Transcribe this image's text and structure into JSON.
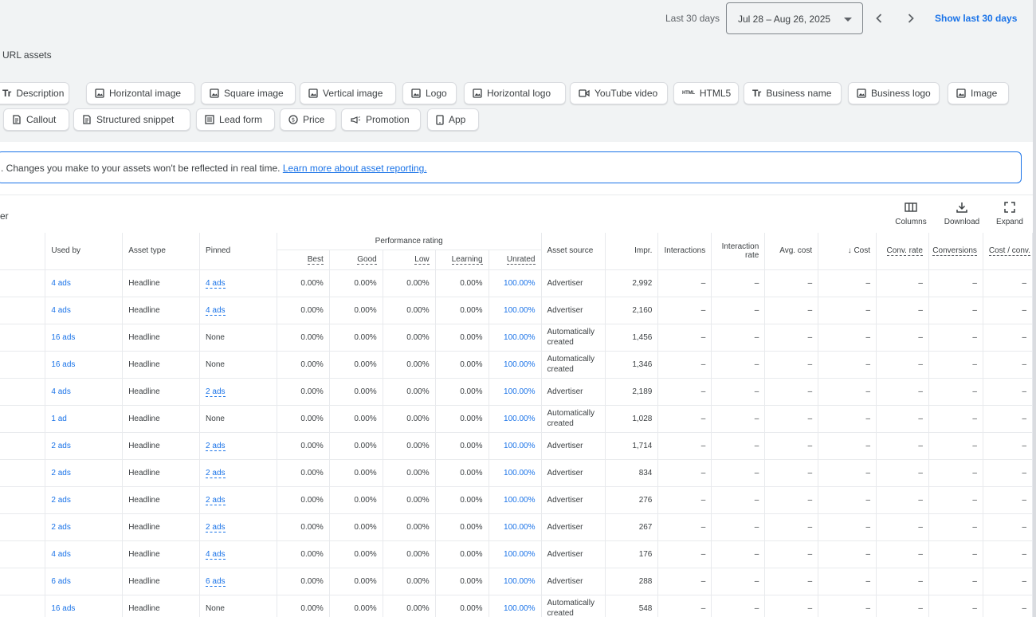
{
  "header": {
    "range_label": "Last 30 days",
    "date_range": "Jul 28 – Aug 26, 2025",
    "show_last": "Show last 30 days"
  },
  "section_title": "URL assets",
  "chips_row1": [
    {
      "label": "Description",
      "icon": "text-icon"
    },
    {
      "label": "Horizontal image",
      "icon": "image-icon"
    },
    {
      "label": "Square image",
      "icon": "image-icon"
    },
    {
      "label": "Vertical image",
      "icon": "image-icon"
    },
    {
      "label": "Logo",
      "icon": "image-icon"
    },
    {
      "label": "Horizontal logo",
      "icon": "image-icon"
    },
    {
      "label": "YouTube video",
      "icon": "video-icon"
    },
    {
      "label": "HTML5",
      "icon": "html5-icon"
    },
    {
      "label": "Business name",
      "icon": "text-icon"
    },
    {
      "label": "Business logo",
      "icon": "image-icon"
    },
    {
      "label": "Image",
      "icon": "image-icon"
    }
  ],
  "chips_row2": [
    {
      "label": "Callout",
      "icon": "callout-icon"
    },
    {
      "label": "Structured snippet",
      "icon": "callout-icon"
    },
    {
      "label": "Lead form",
      "icon": "form-icon"
    },
    {
      "label": "Price",
      "icon": "price-icon"
    },
    {
      "label": "Promotion",
      "icon": "promotion-icon"
    },
    {
      "label": "App",
      "icon": "phone-icon"
    }
  ],
  "banner": {
    "text": ". Changes you make to your assets won't be reflected in real time. ",
    "link": "Learn more about asset reporting."
  },
  "filter_fragment": "er",
  "toolbar": {
    "columns": "Columns",
    "download": "Download",
    "expand": "Expand"
  },
  "table": {
    "headers": {
      "used_by": "Used by",
      "asset_type": "Asset type",
      "pinned": "Pinned",
      "performance": "Performance rating",
      "best": "Best",
      "good": "Good",
      "low": "Low",
      "learning": "Learning",
      "unrated": "Unrated",
      "asset_source": "Asset source",
      "impr": "Impr.",
      "interactions": "Interactions",
      "interaction_rate": "Interaction rate",
      "avg_cost": "Avg. cost",
      "cost": "Cost",
      "conv_rate": "Conv. rate",
      "conversions": "Conversions",
      "cost_conv": "Cost / conv."
    },
    "rows": [
      {
        "used_by": "4 ads",
        "type": "Headline",
        "pinned": "4 ads",
        "pinned_link": true,
        "best": "0.00%",
        "good": "0.00%",
        "low": "0.00%",
        "learning": "0.00%",
        "unrated": "100.00%",
        "source": "Advertiser",
        "impr": "2,992"
      },
      {
        "used_by": "4 ads",
        "type": "Headline",
        "pinned": "4 ads",
        "pinned_link": true,
        "best": "0.00%",
        "good": "0.00%",
        "low": "0.00%",
        "learning": "0.00%",
        "unrated": "100.00%",
        "source": "Advertiser",
        "impr": "2,160"
      },
      {
        "used_by": "16 ads",
        "type": "Headline",
        "pinned": "None",
        "pinned_link": false,
        "best": "0.00%",
        "good": "0.00%",
        "low": "0.00%",
        "learning": "0.00%",
        "unrated": "100.00%",
        "source": "Automatically created",
        "impr": "1,456"
      },
      {
        "used_by": "16 ads",
        "type": "Headline",
        "pinned": "None",
        "pinned_link": false,
        "best": "0.00%",
        "good": "0.00%",
        "low": "0.00%",
        "learning": "0.00%",
        "unrated": "100.00%",
        "source": "Automatically created",
        "impr": "1,346"
      },
      {
        "used_by": "4 ads",
        "type": "Headline",
        "pinned": "2 ads",
        "pinned_link": true,
        "best": "0.00%",
        "good": "0.00%",
        "low": "0.00%",
        "learning": "0.00%",
        "unrated": "100.00%",
        "source": "Advertiser",
        "impr": "2,189"
      },
      {
        "used_by": "1 ad",
        "type": "Headline",
        "pinned": "None",
        "pinned_link": false,
        "best": "0.00%",
        "good": "0.00%",
        "low": "0.00%",
        "learning": "0.00%",
        "unrated": "100.00%",
        "source": "Automatically created",
        "impr": "1,028"
      },
      {
        "used_by": "2 ads",
        "type": "Headline",
        "pinned": "2 ads",
        "pinned_link": true,
        "best": "0.00%",
        "good": "0.00%",
        "low": "0.00%",
        "learning": "0.00%",
        "unrated": "100.00%",
        "source": "Advertiser",
        "impr": "1,714"
      },
      {
        "used_by": "2 ads",
        "type": "Headline",
        "pinned": "2 ads",
        "pinned_link": true,
        "best": "0.00%",
        "good": "0.00%",
        "low": "0.00%",
        "learning": "0.00%",
        "unrated": "100.00%",
        "source": "Advertiser",
        "impr": "834"
      },
      {
        "used_by": "2 ads",
        "type": "Headline",
        "pinned": "2 ads",
        "pinned_link": true,
        "best": "0.00%",
        "good": "0.00%",
        "low": "0.00%",
        "learning": "0.00%",
        "unrated": "100.00%",
        "source": "Advertiser",
        "impr": "276"
      },
      {
        "used_by": "2 ads",
        "type": "Headline",
        "pinned": "2 ads",
        "pinned_link": true,
        "best": "0.00%",
        "good": "0.00%",
        "low": "0.00%",
        "learning": "0.00%",
        "unrated": "100.00%",
        "source": "Advertiser",
        "impr": "267"
      },
      {
        "used_by": "4 ads",
        "type": "Headline",
        "pinned": "4 ads",
        "pinned_link": true,
        "best": "0.00%",
        "good": "0.00%",
        "low": "0.00%",
        "learning": "0.00%",
        "unrated": "100.00%",
        "source": "Advertiser",
        "impr": "176"
      },
      {
        "used_by": "6 ads",
        "type": "Headline",
        "pinned": "6 ads",
        "pinned_link": true,
        "best": "0.00%",
        "good": "0.00%",
        "low": "0.00%",
        "learning": "0.00%",
        "unrated": "100.00%",
        "source": "Advertiser",
        "impr": "288"
      },
      {
        "used_by": "16 ads",
        "type": "Headline",
        "pinned": "None",
        "pinned_link": false,
        "best": "0.00%",
        "good": "0.00%",
        "low": "0.00%",
        "learning": "0.00%",
        "unrated": "100.00%",
        "source": "Automatically created",
        "impr": "548"
      }
    ],
    "empty_value": "–"
  }
}
